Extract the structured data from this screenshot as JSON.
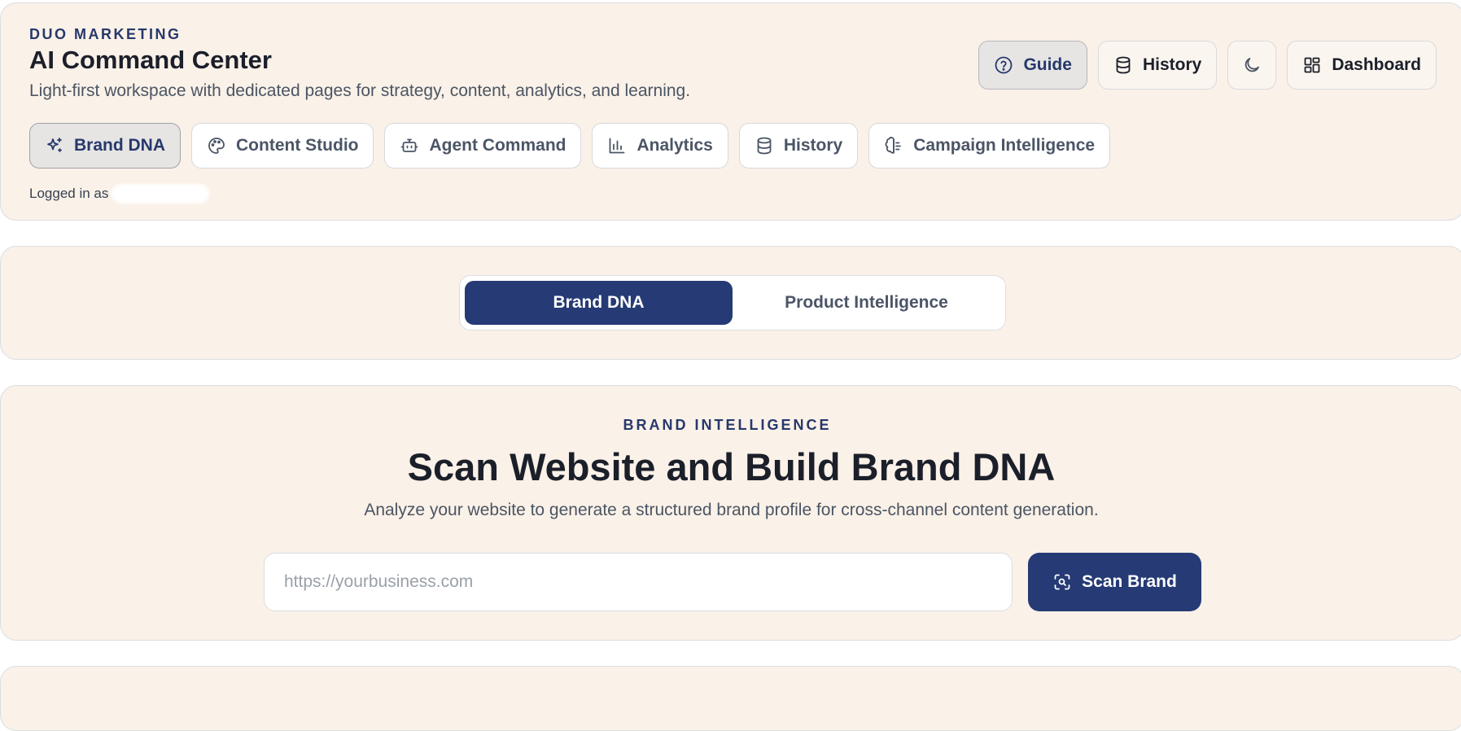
{
  "header": {
    "eyebrow": "DUO MARKETING",
    "title": "AI Command Center",
    "subtitle": "Light-first workspace with dedicated pages for strategy, content, analytics, and learning.",
    "actions": [
      {
        "label": "Guide",
        "icon": "help-circle-icon",
        "active": true
      },
      {
        "label": "History",
        "icon": "database-icon"
      },
      {
        "label": "",
        "icon": "moon-icon"
      },
      {
        "label": "Dashboard",
        "icon": "grid-icon"
      }
    ],
    "nav": [
      {
        "label": "Brand DNA",
        "icon": "sparkles-icon",
        "active": true
      },
      {
        "label": "Content Studio",
        "icon": "palette-icon"
      },
      {
        "label": "Agent Command",
        "icon": "bot-icon"
      },
      {
        "label": "Analytics",
        "icon": "bar-chart-icon"
      },
      {
        "label": "History",
        "icon": "database-icon"
      },
      {
        "label": "Campaign Intelligence",
        "icon": "brain-icon"
      }
    ],
    "logged_in_label": "Logged in as"
  },
  "mode_tabs": [
    {
      "label": "Brand DNA",
      "active": true
    },
    {
      "label": "Product Intelligence",
      "active": false
    }
  ],
  "scan": {
    "eyebrow": "BRAND INTELLIGENCE",
    "title": "Scan Website and Build Brand DNA",
    "description": "Analyze your website to generate a structured brand profile for cross-channel content generation.",
    "url_placeholder": "https://yourbusiness.com",
    "url_value": "",
    "button_label": "Scan Brand",
    "button_icon": "scan-search-icon"
  },
  "colors": {
    "accent": "#263a75",
    "card_bg": "#faf1e8",
    "border": "#dcdde2"
  }
}
